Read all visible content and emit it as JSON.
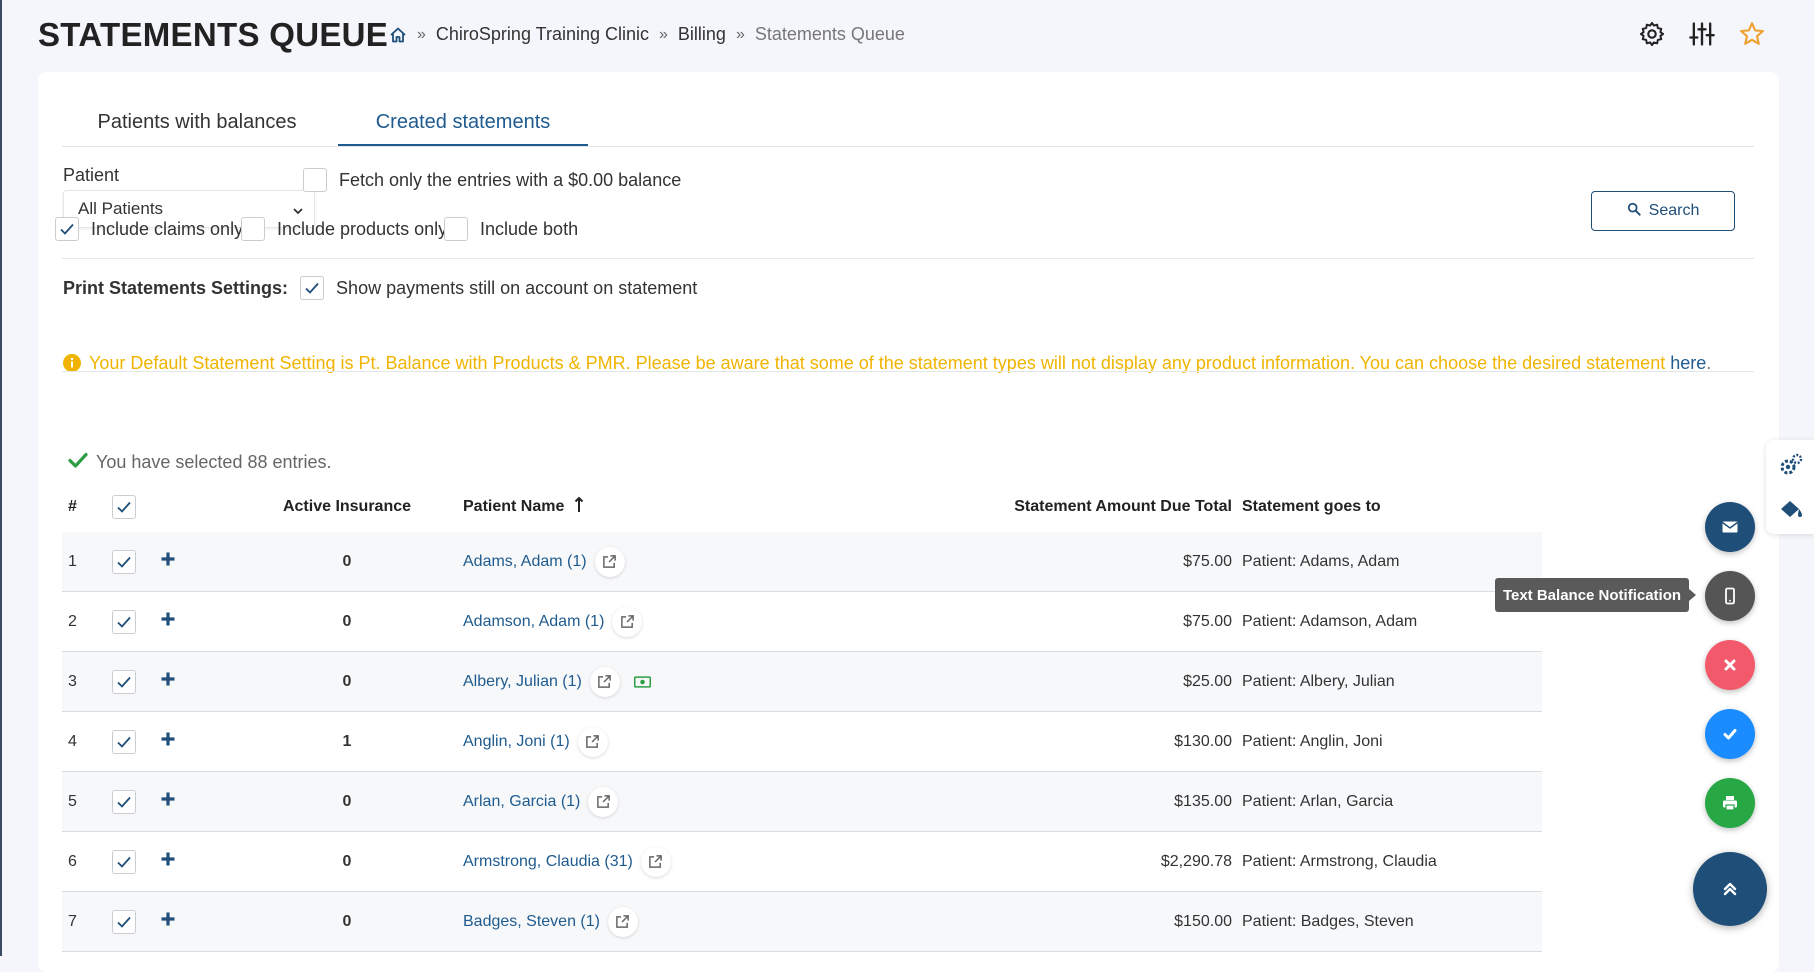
{
  "header": {
    "title": "STATEMENTS QUEUE",
    "breadcrumb": [
      "ChiroSpring Training Clinic",
      "Billing",
      "Statements Queue"
    ],
    "breadcrumb_sep": "»"
  },
  "tabs": [
    {
      "label": "Patients with balances",
      "active": false
    },
    {
      "label": "Created statements",
      "active": true
    }
  ],
  "filters": {
    "patient_label": "Patient",
    "patient_selected": "All Patients",
    "zero_balance_label": "Fetch only the entries with a $0.00 balance",
    "zero_balance_checked": false,
    "claims_only_label": "Include claims only",
    "claims_only_checked": true,
    "products_only_label": "Include products only",
    "products_only_checked": false,
    "both_label": "Include both",
    "both_checked": false,
    "search_label": "Search"
  },
  "print_settings": {
    "label": "Print Statements Settings:",
    "show_payments_label": "Show payments still on account on statement",
    "show_payments_checked": true,
    "notice_text": "Your Default Statement Setting is Pt. Balance with Products & PMR. Please be aware that some of the statement types will not display any product information. You can choose the desired statement",
    "notice_link": "here",
    "notice_end": "."
  },
  "selection": {
    "message": "You have selected 88 entries."
  },
  "table": {
    "headers": {
      "num": "#",
      "insurance": "Active Insurance",
      "name": "Patient Name",
      "amount": "Statement Amount Due Total",
      "goes_to": "Statement goes to"
    },
    "rows": [
      {
        "num": "1",
        "insurance": "0",
        "name": "Adams, Adam (1)",
        "amount": "$75.00",
        "goes_to": "Patient: Adams, Adam",
        "cash": false
      },
      {
        "num": "2",
        "insurance": "0",
        "name": "Adamson, Adam (1)",
        "amount": "$75.00",
        "goes_to": "Patient: Adamson, Adam",
        "cash": false
      },
      {
        "num": "3",
        "insurance": "0",
        "name": "Albery, Julian (1)",
        "amount": "$25.00",
        "goes_to": "Patient: Albery, Julian",
        "cash": true
      },
      {
        "num": "4",
        "insurance": "1",
        "name": "Anglin, Joni (1)",
        "amount": "$130.00",
        "goes_to": "Patient: Anglin, Joni",
        "cash": false
      },
      {
        "num": "5",
        "insurance": "0",
        "name": "Arlan, Garcia (1)",
        "amount": "$135.00",
        "goes_to": "Patient: Arlan, Garcia",
        "cash": false
      },
      {
        "num": "6",
        "insurance": "0",
        "name": "Armstrong, Claudia (31)",
        "amount": "$2,290.78",
        "goes_to": "Patient: Armstrong, Claudia",
        "cash": false
      },
      {
        "num": "7",
        "insurance": "0",
        "name": "Badges, Steven (1)",
        "amount": "$150.00",
        "goes_to": "Patient: Badges, Steven",
        "cash": false
      }
    ]
  },
  "tooltip": "Text Balance Notification",
  "colors": {
    "accent": "#1f5b8f",
    "notice": "#f0b400",
    "fab_email": "#1f4e79",
    "fab_phone": "#555555",
    "fab_cancel": "#f25a6b",
    "fab_confirm": "#1a8cff",
    "fab_print": "#28a745"
  }
}
